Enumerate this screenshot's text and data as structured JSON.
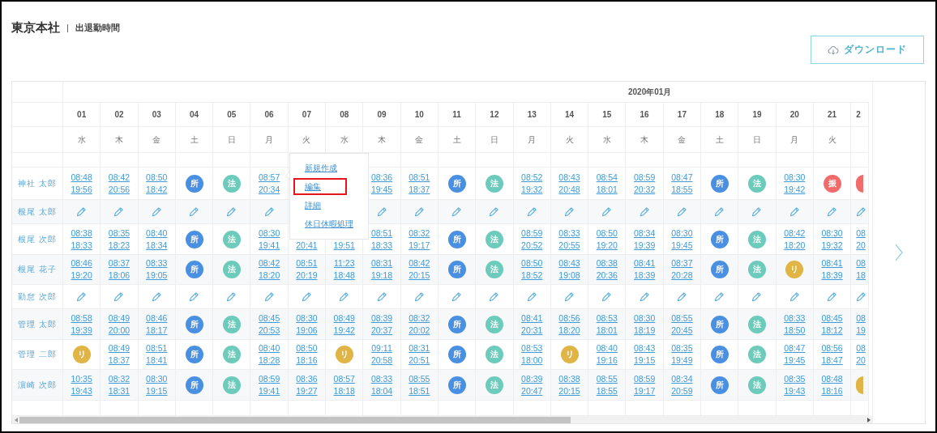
{
  "header": {
    "title": "東京本社",
    "separator": "|",
    "subtitle": "出退勤時間"
  },
  "download_button": {
    "label": "ダウンロード"
  },
  "table": {
    "month": "2020年01月",
    "days": [
      {
        "date": "01",
        "weekday": "水"
      },
      {
        "date": "02",
        "weekday": "木"
      },
      {
        "date": "03",
        "weekday": "金"
      },
      {
        "date": "04",
        "weekday": "土"
      },
      {
        "date": "05",
        "weekday": "日"
      },
      {
        "date": "06",
        "weekday": "月"
      },
      {
        "date": "07",
        "weekday": "火"
      },
      {
        "date": "08",
        "weekday": "水"
      },
      {
        "date": "09",
        "weekday": "木"
      },
      {
        "date": "10",
        "weekday": "金"
      },
      {
        "date": "11",
        "weekday": "土"
      },
      {
        "date": "12",
        "weekday": "日"
      },
      {
        "date": "13",
        "weekday": "月"
      },
      {
        "date": "14",
        "weekday": "火"
      },
      {
        "date": "15",
        "weekday": "水"
      },
      {
        "date": "16",
        "weekday": "木"
      },
      {
        "date": "17",
        "weekday": "金"
      },
      {
        "date": "18",
        "weekday": "土"
      },
      {
        "date": "19",
        "weekday": "日"
      },
      {
        "date": "20",
        "weekday": "月"
      },
      {
        "date": "21",
        "weekday": "火"
      },
      {
        "date": "2"
      }
    ],
    "rows": [
      {
        "name": "神社 太郎",
        "cells": [
          {
            "kind": "time",
            "in": "08:48",
            "out": "19:56"
          },
          {
            "kind": "time",
            "in": "08:42",
            "out": "20:56"
          },
          {
            "kind": "time",
            "in": "08:50",
            "out": "18:42"
          },
          {
            "kind": "badge",
            "label": "所",
            "color": "#4a90e2"
          },
          {
            "kind": "badge",
            "label": "法",
            "color": "#6ccbbb"
          },
          {
            "kind": "time",
            "in": "08:57",
            "out": "20:34"
          },
          {
            "kind": "covered"
          },
          {
            "kind": "covered"
          },
          {
            "kind": "time",
            "in": "08:36",
            "out": "19:45"
          },
          {
            "kind": "time",
            "in": "08:51",
            "out": "18:37"
          },
          {
            "kind": "badge",
            "label": "所",
            "color": "#4a90e2"
          },
          {
            "kind": "badge",
            "label": "法",
            "color": "#6ccbbb"
          },
          {
            "kind": "time",
            "in": "08:52",
            "out": "19:32"
          },
          {
            "kind": "time",
            "in": "08:43",
            "out": "20:48"
          },
          {
            "kind": "time",
            "in": "08:54",
            "out": "18:01"
          },
          {
            "kind": "time",
            "in": "08:59",
            "out": "20:32"
          },
          {
            "kind": "time",
            "in": "08:47",
            "out": "18:55"
          },
          {
            "kind": "badge",
            "label": "所",
            "color": "#4a90e2"
          },
          {
            "kind": "badge",
            "label": "法",
            "color": "#6ccbbb"
          },
          {
            "kind": "time",
            "in": "08:30",
            "out": "19:42"
          },
          {
            "kind": "badge",
            "label": "振",
            "color": "#f26b6b"
          },
          {
            "kind": "badge",
            "color": "#f26b6b"
          }
        ]
      },
      {
        "name": "根尾 太郎",
        "cells": [
          {
            "kind": "edit"
          },
          {
            "kind": "edit"
          },
          {
            "kind": "edit"
          },
          {
            "kind": "edit"
          },
          {
            "kind": "edit"
          },
          {
            "kind": "edit"
          },
          {
            "kind": "covered"
          },
          {
            "kind": "covered"
          },
          {
            "kind": "edit"
          },
          {
            "kind": "edit"
          },
          {
            "kind": "edit"
          },
          {
            "kind": "edit"
          },
          {
            "kind": "edit"
          },
          {
            "kind": "edit"
          },
          {
            "kind": "edit"
          },
          {
            "kind": "edit"
          },
          {
            "kind": "edit"
          },
          {
            "kind": "edit"
          },
          {
            "kind": "edit"
          },
          {
            "kind": "edit"
          },
          {
            "kind": "edit"
          },
          {
            "kind": "edit"
          }
        ]
      },
      {
        "name": "根尾 次郎",
        "cells": [
          {
            "kind": "time",
            "in": "08:38",
            "out": "18:33"
          },
          {
            "kind": "time",
            "in": "08:35",
            "out": "18:23"
          },
          {
            "kind": "time",
            "in": "08:40",
            "out": "18:34"
          },
          {
            "kind": "badge",
            "label": "所",
            "color": "#4a90e2"
          },
          {
            "kind": "badge",
            "label": "法",
            "color": "#6ccbbb"
          },
          {
            "kind": "time",
            "in": "08:30",
            "out": "19:41"
          },
          {
            "kind": "time",
            "out": "20:41"
          },
          {
            "kind": "time",
            "out": "19:51"
          },
          {
            "kind": "time",
            "in": "08:51",
            "out": "18:33"
          },
          {
            "kind": "time",
            "in": "08:32",
            "out": "19:17"
          },
          {
            "kind": "badge",
            "label": "所",
            "color": "#4a90e2"
          },
          {
            "kind": "badge",
            "label": "法",
            "color": "#6ccbbb"
          },
          {
            "kind": "time",
            "in": "08:59",
            "out": "20:52"
          },
          {
            "kind": "time",
            "in": "08:33",
            "out": "20:55"
          },
          {
            "kind": "time",
            "in": "08:50",
            "out": "19:20"
          },
          {
            "kind": "time",
            "in": "08:34",
            "out": "19:39"
          },
          {
            "kind": "time",
            "in": "08:30",
            "out": "19:45"
          },
          {
            "kind": "badge",
            "label": "所",
            "color": "#4a90e2"
          },
          {
            "kind": "badge",
            "label": "法",
            "color": "#6ccbbb"
          },
          {
            "kind": "time",
            "in": "08:42",
            "out": "18:20"
          },
          {
            "kind": "time",
            "in": "08:30",
            "out": "19:32"
          },
          {
            "kind": "time",
            "in": "08",
            "out": "20"
          }
        ]
      },
      {
        "name": "根尾 花子",
        "cells": [
          {
            "kind": "time",
            "in": "08:46",
            "out": "19:20"
          },
          {
            "kind": "time",
            "in": "08:37",
            "out": "18:06"
          },
          {
            "kind": "time",
            "in": "08:33",
            "out": "19:05"
          },
          {
            "kind": "badge",
            "label": "所",
            "color": "#4a90e2"
          },
          {
            "kind": "badge",
            "label": "法",
            "color": "#6ccbbb"
          },
          {
            "kind": "time",
            "in": "08:42",
            "out": "18:20"
          },
          {
            "kind": "time",
            "in": "08:51",
            "out": "20:19"
          },
          {
            "kind": "time",
            "in": "11:23",
            "out": "18:48"
          },
          {
            "kind": "time",
            "in": "08:31",
            "out": "19:18"
          },
          {
            "kind": "time",
            "in": "08:42",
            "out": "20:15"
          },
          {
            "kind": "badge",
            "label": "所",
            "color": "#4a90e2"
          },
          {
            "kind": "badge",
            "label": "法",
            "color": "#6ccbbb"
          },
          {
            "kind": "time",
            "in": "08:50",
            "out": "18:52"
          },
          {
            "kind": "time",
            "in": "08:43",
            "out": "19:08"
          },
          {
            "kind": "time",
            "in": "08:38",
            "out": "20:36"
          },
          {
            "kind": "time",
            "in": "08:41",
            "out": "18:39"
          },
          {
            "kind": "time",
            "in": "08:37",
            "out": "20:28"
          },
          {
            "kind": "badge",
            "label": "所",
            "color": "#4a90e2"
          },
          {
            "kind": "badge",
            "label": "法",
            "color": "#6ccbbb"
          },
          {
            "kind": "badge",
            "label": "リ",
            "color": "#e0b445"
          },
          {
            "kind": "time",
            "in": "08:41",
            "out": "18:39"
          },
          {
            "kind": "time",
            "in": "08",
            "out": "18"
          }
        ]
      },
      {
        "name": "勤怠 次郎",
        "cells": [
          {
            "kind": "edit"
          },
          {
            "kind": "edit"
          },
          {
            "kind": "edit"
          },
          {
            "kind": "edit"
          },
          {
            "kind": "edit"
          },
          {
            "kind": "edit"
          },
          {
            "kind": "edit"
          },
          {
            "kind": "edit"
          },
          {
            "kind": "edit"
          },
          {
            "kind": "edit"
          },
          {
            "kind": "edit"
          },
          {
            "kind": "edit"
          },
          {
            "kind": "edit"
          },
          {
            "kind": "edit"
          },
          {
            "kind": "edit"
          },
          {
            "kind": "edit"
          },
          {
            "kind": "edit"
          },
          {
            "kind": "edit"
          },
          {
            "kind": "edit"
          },
          {
            "kind": "edit"
          },
          {
            "kind": "edit"
          },
          {
            "kind": "edit"
          }
        ]
      },
      {
        "name": "管理 太郎",
        "cells": [
          {
            "kind": "time",
            "in": "08:58",
            "out": "19:39"
          },
          {
            "kind": "time",
            "in": "08:49",
            "out": "20:00"
          },
          {
            "kind": "time",
            "in": "08:46",
            "out": "18:17"
          },
          {
            "kind": "badge",
            "label": "所",
            "color": "#4a90e2"
          },
          {
            "kind": "badge",
            "label": "法",
            "color": "#6ccbbb"
          },
          {
            "kind": "time",
            "in": "08:45",
            "out": "20:53"
          },
          {
            "kind": "time",
            "in": "08:30",
            "out": "19:06"
          },
          {
            "kind": "time",
            "in": "08:49",
            "out": "19:42"
          },
          {
            "kind": "time",
            "in": "08:39",
            "out": "20:37"
          },
          {
            "kind": "time",
            "in": "08:32",
            "out": "20:02"
          },
          {
            "kind": "badge",
            "label": "所",
            "color": "#4a90e2"
          },
          {
            "kind": "badge",
            "label": "法",
            "color": "#6ccbbb"
          },
          {
            "kind": "time",
            "in": "08:41",
            "out": "20:31"
          },
          {
            "kind": "time",
            "in": "08:56",
            "out": "18:20"
          },
          {
            "kind": "time",
            "in": "08:53",
            "out": "18:01"
          },
          {
            "kind": "time",
            "in": "08:30",
            "out": "18:19"
          },
          {
            "kind": "time",
            "in": "08:55",
            "out": "20:45"
          },
          {
            "kind": "badge",
            "label": "所",
            "color": "#4a90e2"
          },
          {
            "kind": "badge",
            "label": "法",
            "color": "#6ccbbb"
          },
          {
            "kind": "time",
            "in": "08:33",
            "out": "18:50"
          },
          {
            "kind": "time",
            "in": "08:45",
            "out": "18:12"
          },
          {
            "kind": "time",
            "in": "08",
            "out": "19"
          }
        ]
      },
      {
        "name": "管理 二郎",
        "cells": [
          {
            "kind": "badge",
            "label": "リ",
            "color": "#e0b445"
          },
          {
            "kind": "time",
            "in": "08:49",
            "out": "18:37"
          },
          {
            "kind": "time",
            "in": "08:51",
            "out": "18:41"
          },
          {
            "kind": "badge",
            "label": "所",
            "color": "#4a90e2"
          },
          {
            "kind": "badge",
            "label": "法",
            "color": "#6ccbbb"
          },
          {
            "kind": "time",
            "in": "08:40",
            "out": "18:28"
          },
          {
            "kind": "time",
            "in": "08:50",
            "out": "18:16"
          },
          {
            "kind": "badge",
            "label": "リ",
            "color": "#e0b445"
          },
          {
            "kind": "time",
            "in": "09:11",
            "out": "20:58"
          },
          {
            "kind": "time",
            "in": "08:31",
            "out": "20:51"
          },
          {
            "kind": "badge",
            "label": "所",
            "color": "#4a90e2"
          },
          {
            "kind": "badge",
            "label": "法",
            "color": "#6ccbbb"
          },
          {
            "kind": "time",
            "in": "08:53",
            "out": "18:00"
          },
          {
            "kind": "badge",
            "label": "リ",
            "color": "#e0b445"
          },
          {
            "kind": "time",
            "in": "08:40",
            "out": "19:16"
          },
          {
            "kind": "time",
            "in": "08:43",
            "out": "19:15"
          },
          {
            "kind": "time",
            "in": "08:35",
            "out": "19:49"
          },
          {
            "kind": "badge",
            "label": "所",
            "color": "#4a90e2"
          },
          {
            "kind": "badge",
            "label": "法",
            "color": "#6ccbbb"
          },
          {
            "kind": "time",
            "in": "08:47",
            "out": "19:45"
          },
          {
            "kind": "time",
            "in": "08:56",
            "out": "18:47"
          },
          {
            "kind": "time",
            "in": "08",
            "out": "20"
          }
        ]
      },
      {
        "name": "濵崎 次郎",
        "cells": [
          {
            "kind": "time",
            "in": "10:35",
            "out": "19:43"
          },
          {
            "kind": "time",
            "in": "08:32",
            "out": "18:31"
          },
          {
            "kind": "time",
            "in": "08:30",
            "out": "19:15"
          },
          {
            "kind": "badge",
            "label": "所",
            "color": "#4a90e2"
          },
          {
            "kind": "badge",
            "label": "法",
            "color": "#6ccbbb"
          },
          {
            "kind": "time",
            "in": "08:59",
            "out": "19:41"
          },
          {
            "kind": "time",
            "in": "08:36",
            "out": "19:27"
          },
          {
            "kind": "time",
            "in": "08:57",
            "out": "18:18"
          },
          {
            "kind": "time",
            "in": "08:33",
            "out": "18:04"
          },
          {
            "kind": "time",
            "in": "08:55",
            "out": "18:51"
          },
          {
            "kind": "badge",
            "label": "所",
            "color": "#4a90e2"
          },
          {
            "kind": "badge",
            "label": "法",
            "color": "#6ccbbb"
          },
          {
            "kind": "time",
            "in": "08:39",
            "out": "20:47"
          },
          {
            "kind": "time",
            "in": "08:38",
            "out": "20:15"
          },
          {
            "kind": "time",
            "in": "08:55",
            "out": "18:55"
          },
          {
            "kind": "time",
            "in": "08:59",
            "out": "19:17"
          },
          {
            "kind": "time",
            "in": "08:34",
            "out": "20:59"
          },
          {
            "kind": "badge",
            "label": "所",
            "color": "#4a90e2"
          },
          {
            "kind": "badge",
            "label": "法",
            "color": "#6ccbbb"
          },
          {
            "kind": "time",
            "in": "08:35",
            "out": "19:43"
          },
          {
            "kind": "time",
            "in": "08:48",
            "out": "18:16"
          },
          {
            "kind": "badge",
            "color": "#e0b445"
          }
        ]
      }
    ]
  },
  "popup": {
    "items": [
      {
        "label": "新規作成",
        "selected": false
      },
      {
        "label": "編集",
        "selected": true
      },
      {
        "label": "詳細",
        "selected": false
      },
      {
        "label": "休日休暇処理",
        "selected": false
      }
    ]
  }
}
